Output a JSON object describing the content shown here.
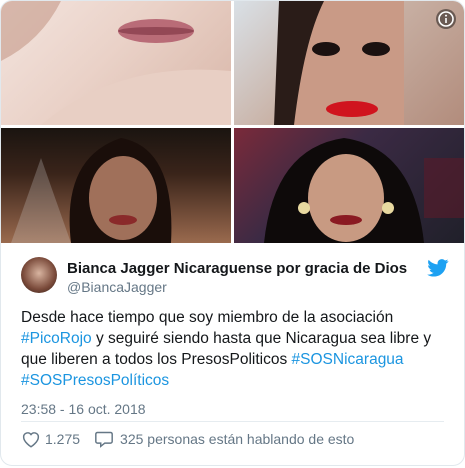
{
  "media": {
    "photos": [
      "photo-1",
      "photo-2",
      "photo-3",
      "photo-4"
    ],
    "info_icon": "info-icon"
  },
  "author": {
    "name": "Bianca Jagger Nicaraguense por gracia de Dios",
    "handle": "@BiancaJagger",
    "verified_icon": "twitter-bird-icon"
  },
  "tweet": {
    "t1": "Desde hace tiempo que soy miembro de la asociación ",
    "tag1": "#PicoRojo",
    "t2": " y seguiré siendo hasta que Nicaragua sea libre y que liberen a todos los PresosPoliticos ",
    "tag2": "#SOSNicaragua",
    "t3": " ",
    "tag3": "#SOSPresosPolíticos"
  },
  "timestamp": "23:58 - 16 oct. 2018",
  "actions": {
    "likes": "1.275",
    "replies_text": "325 personas están hablando de esto"
  },
  "colors": {
    "link": "#1b95e0",
    "muted": "#657786",
    "text": "#14171a"
  }
}
